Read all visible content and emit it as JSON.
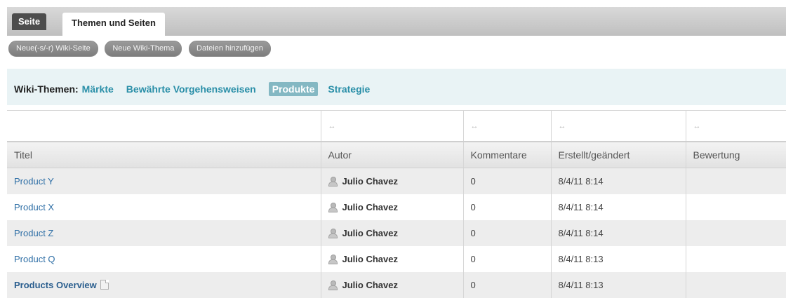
{
  "tabs": {
    "page_tab": "Seite",
    "topics_tab": "Themen und Seiten"
  },
  "actions": {
    "new_page": "Neue(-s/-r) Wiki-Seite",
    "new_topic": "Neue Wiki-Thema",
    "add_files": "Dateien hinzufügen"
  },
  "themes": {
    "label": "Wiki-Themen:",
    "items": [
      {
        "label": "Märkte",
        "active": false
      },
      {
        "label": "Bewährte Vorgehensweisen",
        "active": false
      },
      {
        "label": "Produkte",
        "active": true
      },
      {
        "label": "Strategie",
        "active": false
      }
    ]
  },
  "table": {
    "resize_handle": "↔",
    "columns": [
      "Titel",
      "Autor",
      "Kommentare",
      "Erstellt/geändert",
      "Bewertung"
    ],
    "rows": [
      {
        "title": "Product Y",
        "author": "Julio Chavez",
        "comments": "0",
        "modified": "8/4/11 8:14",
        "rating": ""
      },
      {
        "title": "Product X",
        "author": "Julio Chavez",
        "comments": "0",
        "modified": "8/4/11 8:14",
        "rating": ""
      },
      {
        "title": "Product Z",
        "author": "Julio Chavez",
        "comments": "0",
        "modified": "8/4/11 8:14",
        "rating": ""
      },
      {
        "title": "Product Q",
        "author": "Julio Chavez",
        "comments": "0",
        "modified": "8/4/11 8:13",
        "rating": ""
      },
      {
        "title": "Products Overview",
        "author": "Julio Chavez",
        "comments": "0",
        "modified": "8/4/11 8:13",
        "rating": ""
      }
    ]
  },
  "colors": {
    "accent_link": "#2a8fa8",
    "active_theme_bg": "#84b8c3",
    "title_link": "#2f6fa6"
  }
}
